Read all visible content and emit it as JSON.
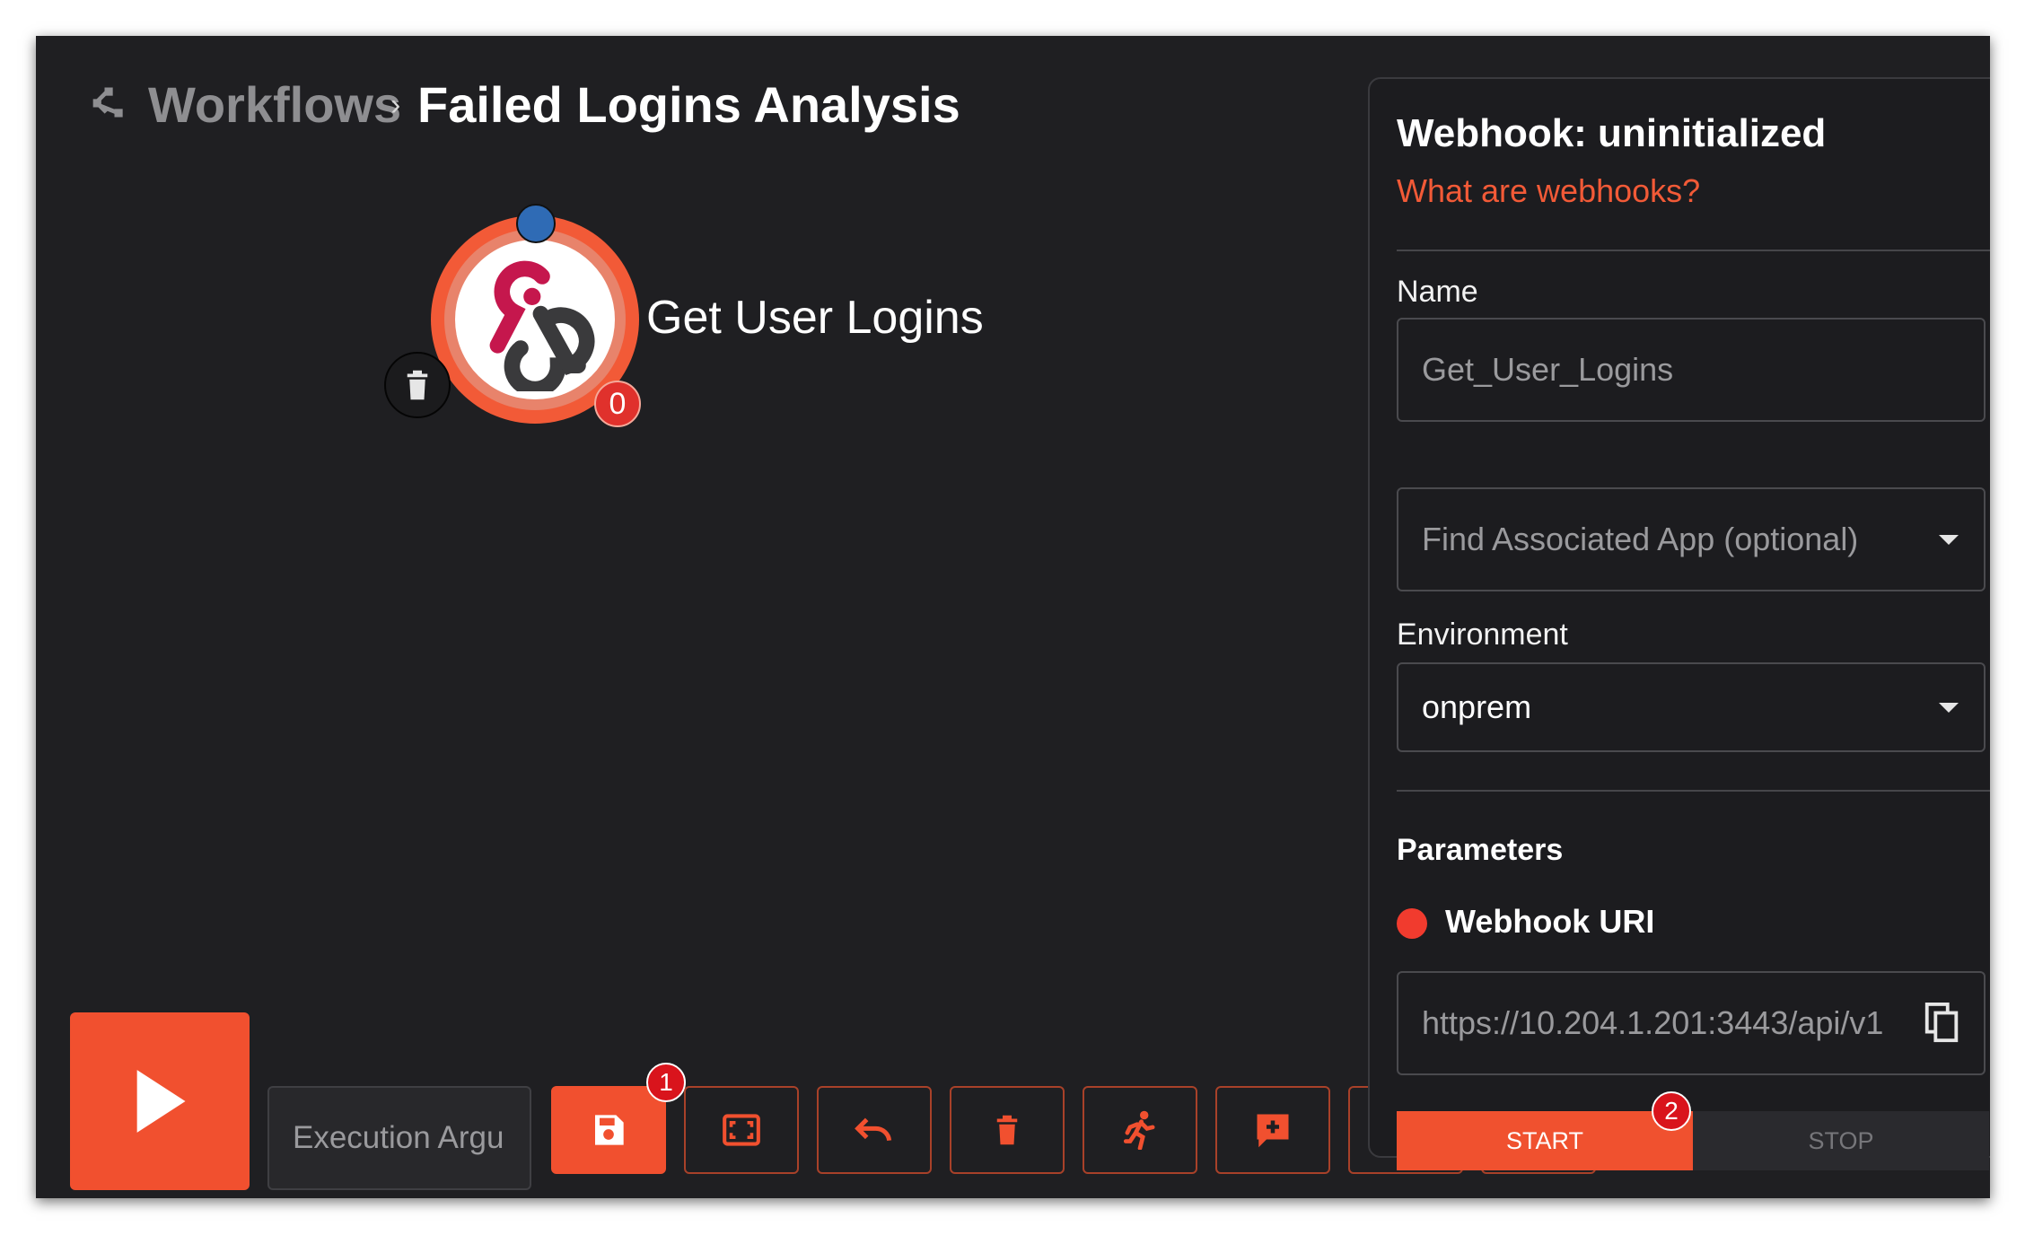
{
  "breadcrumb": {
    "parent": "Workflows",
    "separator": "›",
    "current": "Failed Logins Analysis"
  },
  "node": {
    "label": "Get User Logins",
    "badge_count": "0",
    "icon": "webhook-icon"
  },
  "panel": {
    "title": "Webhook: uninitialized",
    "help_link": "What are webhooks?",
    "name_label": "Name",
    "name_placeholder": "Get_User_Logins",
    "app_select_placeholder": "Find Associated App (optional)",
    "environment_label": "Environment",
    "environment_value": "onprem",
    "parameters_heading": "Parameters",
    "webhook_uri_label": "Webhook URI",
    "webhook_uri_value": "https://10.204.1.201:3443/api/v1",
    "start_label": "START",
    "start_badge": "2",
    "stop_label": "STOP"
  },
  "toolbar": {
    "execution_placeholder": "Execution Argu",
    "save_badge": "1",
    "buttons": [
      "save-icon",
      "fit-view-icon",
      "undo-icon",
      "delete-icon",
      "run-test-icon",
      "add-comment-icon",
      "edit-icon",
      "refresh-icon"
    ]
  },
  "colors": {
    "accent": "#f1502f",
    "background": "#1f1f22",
    "badge": "#d9141c",
    "node_top_dot": "#2f6bb5"
  }
}
